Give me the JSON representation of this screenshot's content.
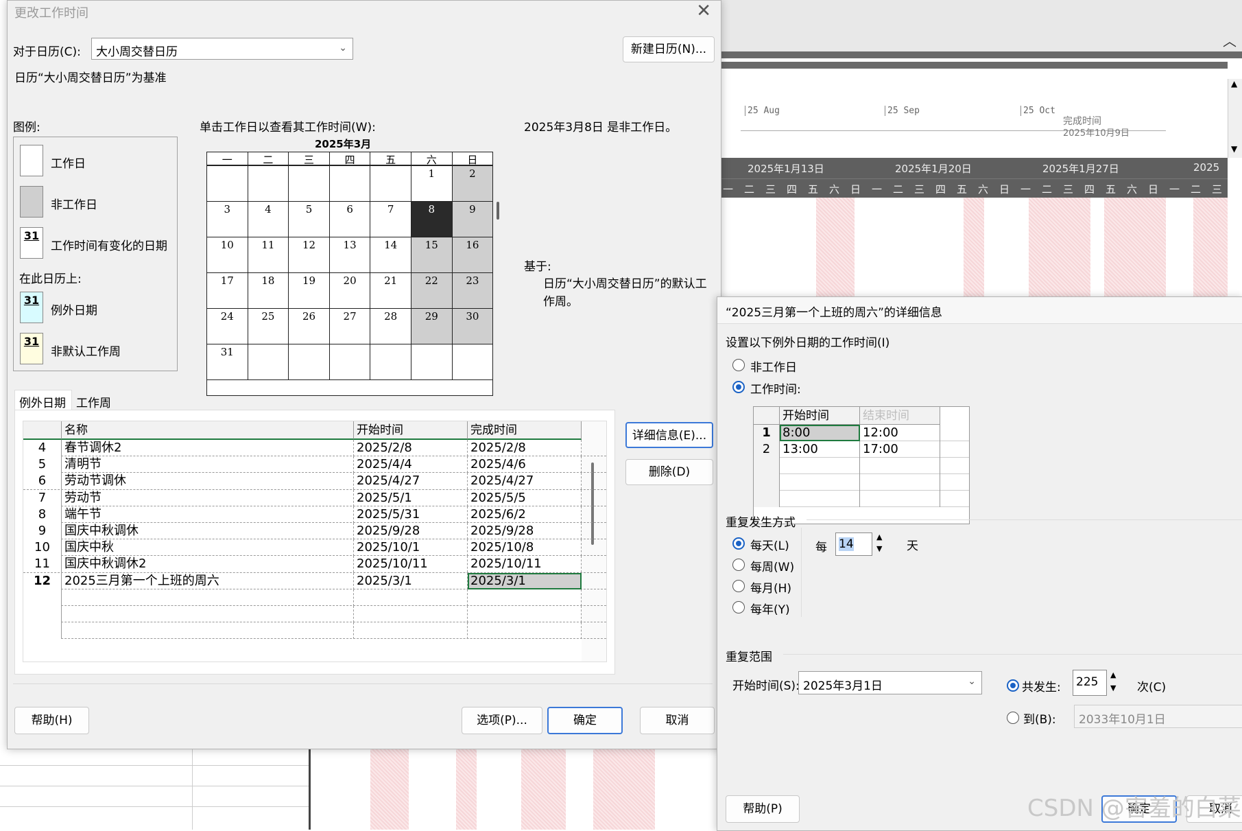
{
  "background": {
    "timeline": {
      "ticks": [
        "25 Aug",
        "25 Sep",
        "25 Oct"
      ],
      "finish_label": "完成时间",
      "finish_date": "2025年10月9日"
    },
    "weeks": [
      "2025年1月13日",
      "2025年1月20日",
      "2025年1月27日",
      "2025"
    ],
    "days": [
      "一",
      "二",
      "三",
      "四",
      "五",
      "六",
      "日",
      "一",
      "二",
      "三",
      "四",
      "五",
      "六",
      "日",
      "一",
      "二",
      "三",
      "四",
      "五",
      "六",
      "日",
      "一",
      "二",
      "三"
    ]
  },
  "main_dialog": {
    "title": "更改工作时间",
    "calendar_for_label": "对于日历(C):",
    "calendar_selected": "大小周交替日历",
    "new_calendar_button": "新建日历(N)...",
    "base_note": "日历“大小周交替日历”为基准",
    "legend": {
      "title": "图例:",
      "working": "工作日",
      "nonworking": "非工作日",
      "changed": "工作时间有变化的日期",
      "on_this_calendar": "在此日历上:",
      "exception": "例外日期",
      "nondefault_week": "非默认工作周",
      "swatch_num": "31"
    },
    "calendar_hint": "单击工作日以查看其工作时间(W):",
    "month_title": "2025年3月",
    "weekdays": [
      "一",
      "二",
      "三",
      "四",
      "五",
      "六",
      "日"
    ],
    "selected_info": "2025年3月8日 是非工作日。",
    "based_on_label": "基于:",
    "based_on_text": "日历“大小周交替日历”的默认工作周。",
    "tabs": [
      "例外日期",
      "工作周"
    ],
    "table": {
      "headers": [
        "名称",
        "开始时间",
        "完成时间"
      ],
      "rows": [
        {
          "id": "4",
          "name": "春节调休2",
          "start": "2025/2/8",
          "finish": "2025/2/8"
        },
        {
          "id": "5",
          "name": "清明节",
          "start": "2025/4/4",
          "finish": "2025/4/6"
        },
        {
          "id": "6",
          "name": "劳动节调休",
          "start": "2025/4/27",
          "finish": "2025/4/27"
        },
        {
          "id": "7",
          "name": "劳动节",
          "start": "2025/5/1",
          "finish": "2025/5/5"
        },
        {
          "id": "8",
          "name": "端午节",
          "start": "2025/5/31",
          "finish": "2025/6/2"
        },
        {
          "id": "9",
          "name": "国庆中秋调休",
          "start": "2025/9/28",
          "finish": "2025/9/28"
        },
        {
          "id": "10",
          "name": "国庆中秋",
          "start": "2025/10/1",
          "finish": "2025/10/8"
        },
        {
          "id": "11",
          "name": "国庆中秋调休2",
          "start": "2025/10/11",
          "finish": "2025/10/11"
        },
        {
          "id": "12",
          "name": "2025三月第一个上班的周六",
          "start": "2025/3/1",
          "finish": "2025/3/1"
        }
      ]
    },
    "details_button": "详细信息(E)...",
    "delete_button": "删除(D)",
    "help_button": "帮助(H)",
    "options_button": "选项(P)...",
    "ok_button": "确定",
    "cancel_button": "取消"
  },
  "details_dialog": {
    "title": "“2025三月第一个上班的周六”的详细信息",
    "set_label": "设置以下例外日期的工作时间(I)",
    "nonworking_radio": "非工作日",
    "working_radio": "工作时间:",
    "times_headers": [
      "开始时间",
      "结束时间"
    ],
    "times": [
      {
        "id": "1",
        "start": "8:00",
        "end": "12:00"
      },
      {
        "id": "2",
        "start": "13:00",
        "end": "17:00"
      }
    ],
    "recurrence_label": "重复发生方式",
    "daily": "每天(L)",
    "weekly": "每周(W)",
    "monthly": "每月(H)",
    "yearly": "每年(Y)",
    "every_label": "每",
    "every_value": "14",
    "unit_label": "天",
    "range_label": "重复范围",
    "start_label": "开始时间(S):",
    "start_value": "2025年3月1日",
    "occurrences_radio": "共发生:",
    "occurrences_value": "225",
    "occurrences_unit": "次(C)",
    "until_radio": "到(B):",
    "until_value": "2033年10月1日",
    "help_button": "帮助(P)",
    "ok_button": "确定",
    "cancel_button": "取消"
  },
  "watermark": "CSDN @害羞的白菜"
}
